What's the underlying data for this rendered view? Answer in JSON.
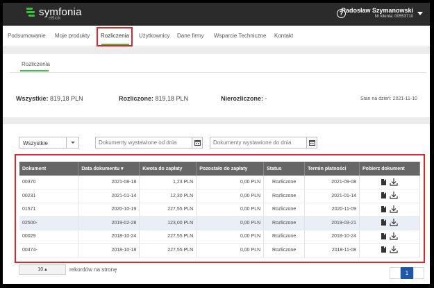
{
  "app": {
    "logo_text": "symfonia",
    "logo_sub": "eBiok",
    "brand_color": "#3fbf3f"
  },
  "user": {
    "name": "Radosław Szymanowski",
    "client": "Nr klienta: 00553710"
  },
  "nav": {
    "items": [
      "Podsumowanie",
      "Moje produkty",
      "Rozliczenia",
      "Użytkownicy",
      "Dane firmy",
      "Wsparcie Techniczne",
      "Kontakt"
    ],
    "active": "Rozliczenia"
  },
  "subtab": {
    "label": "Rozliczenia"
  },
  "summary": {
    "all_label": "Wszystkie:",
    "all_value": "819,18 PLN",
    "settled_label": "Rozliczone:",
    "settled_value": "819,18 PLN",
    "unsettled_label": "Nierozliczone:",
    "unsettled_value": "-",
    "date": "Stan na dzień: 2021-11-10"
  },
  "filters": {
    "select_value": "Wszystkie",
    "date_from_placeholder": "Dokumenty wystawione od dnia",
    "date_to_placeholder": "Dokumenty wystawione do dnia"
  },
  "table": {
    "headers": [
      "Dokument",
      "Data dokumentu ▾",
      "Kwota do zapłaty",
      "Pozostało do zapłaty",
      "Status",
      "Termin płatności",
      "Pobierz dokument"
    ],
    "rows": [
      [
        "00370",
        "2021-08-18",
        "1,23 PLN",
        "0,00 PLN",
        "Rozliczone",
        "2021-09-08"
      ],
      [
        "00231",
        "2021-01-14",
        "12,30 PLN",
        "0,00 PLN",
        "Rozliczone",
        "2021-01-14"
      ],
      [
        "01571",
        "2020-10-19",
        "227,55 PLN",
        "0,00 PLN",
        "Rozliczone",
        "2020-11-09"
      ],
      [
        "02500-",
        "2019-02-28",
        "123,00 PLN",
        "0,00 PLN",
        "Rozliczone",
        "2019-03-21"
      ],
      [
        "00029",
        "2018-10-24",
        "227,55 PLN",
        "0,00 PLN",
        "Rozliczone",
        "2018-10-24"
      ],
      [
        "00474-",
        "2018-10-18",
        "227,55 PLN",
        "0,00 PLN",
        "Rozliczone",
        "2018-11-08"
      ]
    ]
  },
  "pagination": {
    "page_size": "10 ▴",
    "page_size_label": "rekordów na stronę",
    "current_page": "1"
  }
}
